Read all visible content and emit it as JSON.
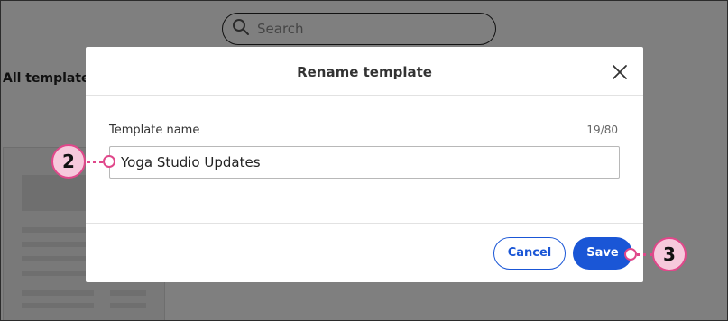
{
  "background": {
    "search_placeholder": "Search",
    "heading": "All template"
  },
  "modal": {
    "title": "Rename template",
    "field_label": "Template name",
    "char_count": "19/80",
    "input_value": "Yoga Studio Updates",
    "cancel_label": "Cancel",
    "save_label": "Save"
  },
  "callouts": {
    "input_step": "2",
    "save_step": "3"
  },
  "colors": {
    "accent": "#1a56d6",
    "callout_border": "#e0478a",
    "callout_fill": "#f6c9dc"
  }
}
